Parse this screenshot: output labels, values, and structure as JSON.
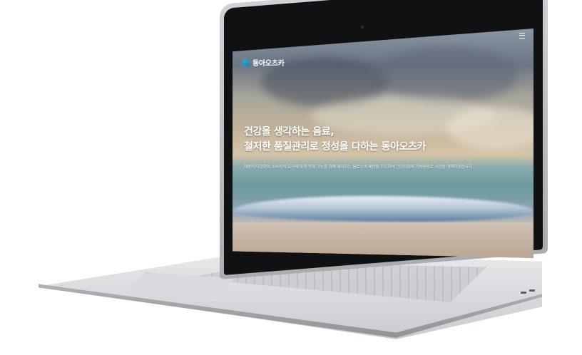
{
  "website": {
    "brand": "동아오츠카",
    "headline": {
      "line1": "건강을 생각하는 음료,",
      "line2": "철저한 품질관리로 정성을 다하는 동아오츠카"
    },
    "subtext": "제품의 다양화와 소비자의 요구에 맞게 맛과 기능을 함께 제공하는 음료수의 패턴을 주도하여 건강지향적 기능성음료 시장을 개척하였습니다."
  },
  "icons": {
    "menu": "hamburger-menu-icon",
    "logo": "brand-logo-icon"
  },
  "colors": {
    "logo_accent": "#2fb4c8",
    "headline_text": "#ffffff"
  }
}
